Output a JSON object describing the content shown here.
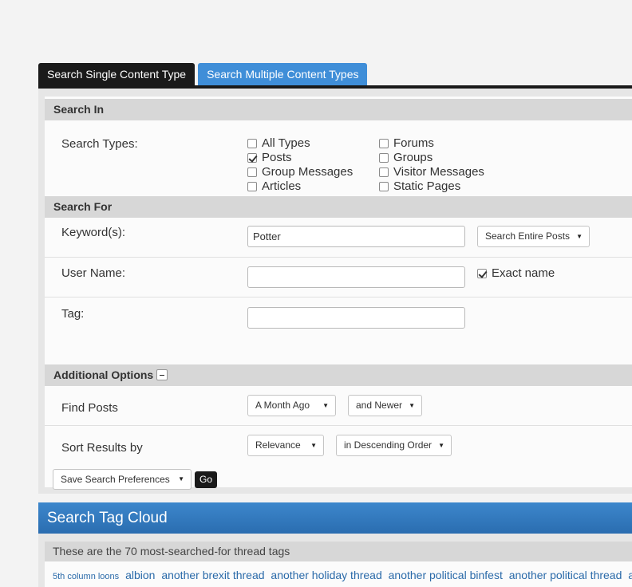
{
  "tabs": {
    "single": "Search Single Content Type",
    "multiple": "Search Multiple Content Types"
  },
  "search_in": {
    "heading": "Search In",
    "types_label": "Search Types:",
    "types": [
      {
        "label": "All Types",
        "checked": false
      },
      {
        "label": "Posts",
        "checked": true
      },
      {
        "label": "Group Messages",
        "checked": false
      },
      {
        "label": "Articles",
        "checked": false
      },
      {
        "label": "Forums",
        "checked": false
      },
      {
        "label": "Groups",
        "checked": false
      },
      {
        "label": "Visitor Messages",
        "checked": false
      },
      {
        "label": "Static Pages",
        "checked": false
      }
    ]
  },
  "search_for": {
    "heading": "Search For",
    "keyword_label": "Keyword(s):",
    "keyword_value": "Potter",
    "scope_select": "Search Entire Posts",
    "username_label": "User Name:",
    "username_value": "",
    "exact_name_label": "Exact name",
    "exact_name_checked": true,
    "tag_label": "Tag:",
    "tag_value": ""
  },
  "additional": {
    "heading": "Additional Options",
    "find_posts_label": "Find Posts",
    "date_select": "A Month Ago",
    "date_dir_select": "and Newer",
    "sort_label": "Sort Results by",
    "sort_select": "Relevance",
    "order_select": "in Descending Order",
    "prefs_select": "Save Search Preferences",
    "go_label": "Go"
  },
  "tag_cloud": {
    "heading": "Search Tag Cloud",
    "subheading": "These are the 70 most-searched-for thread tags",
    "tags": [
      {
        "text": "5th column loons",
        "size": "small"
      },
      {
        "text": "albion",
        "size": "normal"
      },
      {
        "text": "another brexit thread",
        "size": "normal"
      },
      {
        "text": "another holiday thread",
        "size": "normal"
      },
      {
        "text": "another political binfest",
        "size": "normal"
      },
      {
        "text": "another political thread",
        "size": "normal"
      },
      {
        "text": "an",
        "size": "normal"
      }
    ]
  },
  "icons": {
    "dropdown": "triangle-down-icon",
    "collapse": "minus-icon"
  }
}
